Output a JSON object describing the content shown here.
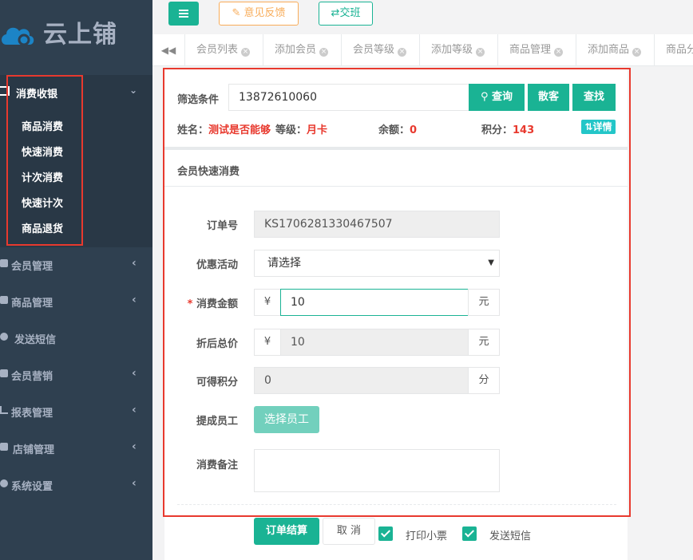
{
  "app": {
    "logo_text": "云上铺"
  },
  "sidebar": {
    "active_group": {
      "label": "消费收银",
      "items": [
        "商品消费",
        "快速消费",
        "计次消费",
        "快速计次",
        "商品退货"
      ]
    },
    "items": [
      {
        "label": "会员管理",
        "icon": "users-icon",
        "has_arrow": true
      },
      {
        "label": "商品管理",
        "icon": "database-icon",
        "has_arrow": true
      },
      {
        "label": "发送短信",
        "icon": "comment-icon",
        "has_arrow": false
      },
      {
        "label": "会员营销",
        "icon": "briefcase-icon",
        "has_arrow": true
      },
      {
        "label": "报表管理",
        "icon": "line-chart-icon",
        "has_arrow": true
      },
      {
        "label": "店铺管理",
        "icon": "bank-icon",
        "has_arrow": true
      },
      {
        "label": "系统设置",
        "icon": "share-icon",
        "has_arrow": true
      }
    ]
  },
  "topbar": {
    "feedback_label": "意见反馈",
    "shift_label": "交班"
  },
  "tabs": [
    "会员列表",
    "添加会员",
    "会员等级",
    "添加等级",
    "商品管理",
    "添加商品",
    "商品分"
  ],
  "filter": {
    "label": "筛选条件",
    "value": "13872610060",
    "query_label": "查询",
    "walkin_label": "散客",
    "find_label": "查找"
  },
  "member": {
    "name_label": "姓名：",
    "name": "测试是否能够",
    "level_label": "等级：",
    "level": "月卡",
    "balance_label": "余额：",
    "balance": "0",
    "points_label": "积分：",
    "points": "143",
    "detail_label": "详情"
  },
  "section_title": "会员快速消费",
  "form": {
    "order_no_label": "订单号",
    "order_no": "KS1706281330467507",
    "promo_label": "优惠活动",
    "promo_value": "请选择",
    "amount_label": "消费金额",
    "amount": "10",
    "discount_total_label": "折后总价",
    "discount_total": "10",
    "points_earn_label": "可得积分",
    "points_earn": "0",
    "staff_label": "提成员工",
    "staff_button": "选择员工",
    "remark_label": "消费备注",
    "currency": "¥",
    "yuan_unit": "元",
    "points_unit": "分"
  },
  "actions": {
    "checkout_label": "订单结算",
    "cancel_label": "取 消",
    "print_label": "打印小票",
    "sms_label": "发送短信"
  },
  "colors": {
    "accent": "#1ab394",
    "sidebar_bg": "#2f4050",
    "highlight_red": "#e8392e",
    "warning": "#f8ac59",
    "info": "#23c6c8"
  }
}
